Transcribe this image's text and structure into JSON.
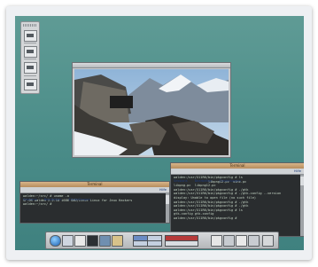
{
  "terminal_left": {
    "title": "Terminal",
    "menu": [
      "Sessions",
      "Bearbeiten",
      "Einstellungen"
    ],
    "help": "Hilfe",
    "lines": [
      "walden:~/src/ # uname -a",
      "SF-OS walden 2.2.18 i686 GNU/Linux Linux for Jeux Hackers",
      "walden:~/src/ # "
    ]
  },
  "terminal_right": {
    "title": "Terminal",
    "menu": [
      "Sessions",
      "Bearbeiten",
      "Einstellungen"
    ],
    "help": "Hilfe",
    "lines": [
      "walden:/usr/X11R6/bin/pkgconfig # ls",
      "                  libpng12.pc  xine.pc",
      "libpng.pc  libpng12.pc",
      "walden:/usr/X11R6/bin/pkgconfig # ./gtk",
      "walden:/usr/X11R6/bin/pkgconfig # ./gtk-config --version",
      "display: Unable to open file (no such file)",
      "walden:/usr/X11R6/bin/pkgconfig # ./gtk",
      "walden:/usr/X11R6/bin/pkgconfig # ./gtk",
      "walden:/usr/X11R6/bin/pkgconfig # ls",
      "gtk-config gtk-config",
      "walden:/usr/X11R6/bin/pkgconfig # "
    ]
  },
  "colors": {
    "desktop": "#4a8c88",
    "terminal_bg": "#2a2d2f",
    "terminal_text": "#c8d8c8",
    "menu_text": "#1f3b79",
    "title_bar": "#b78c5c"
  },
  "dock_icons": [
    "window-icon",
    "window-icon",
    "window-icon"
  ],
  "taskbar_icons": [
    "globe-icon",
    "home-icon",
    "printer-icon",
    "terminal-icon",
    "monitor-icon",
    "folder-icon",
    "tools-icon",
    "trash-icon"
  ]
}
